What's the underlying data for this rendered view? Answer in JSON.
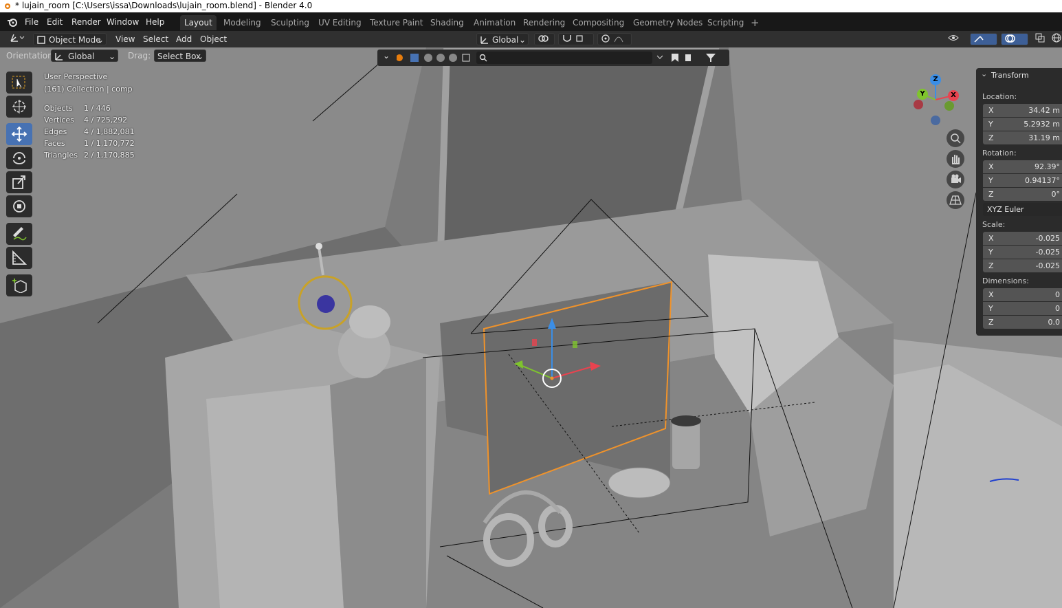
{
  "titlebar": {
    "title": "* lujain_room [C:\\Users\\issa\\Downloads\\lujain_room.blend] - Blender 4.0"
  },
  "menu": [
    "File",
    "Edit",
    "Render",
    "Window",
    "Help"
  ],
  "workspaces": [
    "Layout",
    "Modeling",
    "Sculpting",
    "UV Editing",
    "Texture Paint",
    "Shading",
    "Animation",
    "Rendering",
    "Compositing",
    "Geometry Nodes",
    "Scripting"
  ],
  "workspace_add": "+",
  "header": {
    "mode": "Object Mode",
    "menus": [
      "View",
      "Select",
      "Add",
      "Object"
    ],
    "transform_orientation": "Global"
  },
  "tool_settings": {
    "orientation_label": "Orientation:",
    "orientation_value": "Global",
    "drag_label": "Drag:",
    "drag_value": "Select Box"
  },
  "viewport_info": {
    "perspective": "User Perspective",
    "collection": "(161) Collection | comp",
    "stats": [
      {
        "label": "Objects",
        "value": "1 / 446"
      },
      {
        "label": "Vertices",
        "value": "4 / 725,292"
      },
      {
        "label": "Edges",
        "value": "4 / 1,882,081"
      },
      {
        "label": "Faces",
        "value": "1 / 1,170,772"
      },
      {
        "label": "Triangles",
        "value": "2 / 1,170,885"
      }
    ]
  },
  "gizmo_axes": {
    "x": "X",
    "y": "Y",
    "z": "Z"
  },
  "transform_panel": {
    "title": "Transform",
    "location_label": "Location:",
    "location": [
      {
        "axis": "X",
        "value": "34.42 m"
      },
      {
        "axis": "Y",
        "value": "5.2932 m"
      },
      {
        "axis": "Z",
        "value": "31.19 m"
      }
    ],
    "rotation_label": "Rotation:",
    "rotation": [
      {
        "axis": "X",
        "value": "92.39°"
      },
      {
        "axis": "Y",
        "value": "0.94137°"
      },
      {
        "axis": "Z",
        "value": "0°"
      }
    ],
    "rotation_mode": "XYZ Euler",
    "scale_label": "Scale:",
    "scale": [
      {
        "axis": "X",
        "value": "-0.025"
      },
      {
        "axis": "Y",
        "value": "-0.025"
      },
      {
        "axis": "Z",
        "value": "-0.025"
      }
    ],
    "dimensions_label": "Dimensions:",
    "dimensions": [
      {
        "axis": "X",
        "value": "0"
      },
      {
        "axis": "Y",
        "value": "0"
      },
      {
        "axis": "Z",
        "value": "0.0"
      }
    ]
  },
  "colors": {
    "accent": "#4772b3",
    "selection": "#f0932b",
    "axis_x": "#e8434f",
    "axis_y": "#7fc42d",
    "axis_z": "#3b8ee6"
  }
}
